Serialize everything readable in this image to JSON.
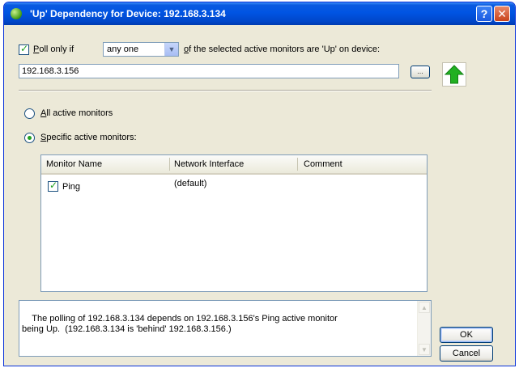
{
  "window": {
    "title": "'Up' Dependency for Device: 192.168.3.134",
    "help_glyph": "?",
    "close_glyph": "✕",
    "title_icon": "green-orb-icon"
  },
  "poll": {
    "checked": true,
    "label_prefix": "Poll only if",
    "dropdown_value": "any one",
    "label_suffix": "of the selected active monitors are 'Up' on device:",
    "device": "192.168.3.156",
    "browse_label": "...",
    "status_icon": "green-up-arrow-icon",
    "status_color": "#22b022"
  },
  "monitor_mode": {
    "options": [
      {
        "label": "All active monitors",
        "selected": false
      },
      {
        "label": "Specific active monitors:",
        "selected": true
      }
    ]
  },
  "monitors": {
    "columns": [
      "Monitor Name",
      "Network Interface",
      "Comment"
    ],
    "rows": [
      {
        "checked": true,
        "name": "Ping",
        "interface": "(default)",
        "comment": ""
      }
    ]
  },
  "description": "The polling of 192.168.3.134 depends on 192.168.3.156's Ping active monitor\nbeing Up.  (192.168.3.134 is 'behind' 192.168.3.156.)",
  "buttons": {
    "ok": "OK",
    "cancel": "Cancel"
  }
}
